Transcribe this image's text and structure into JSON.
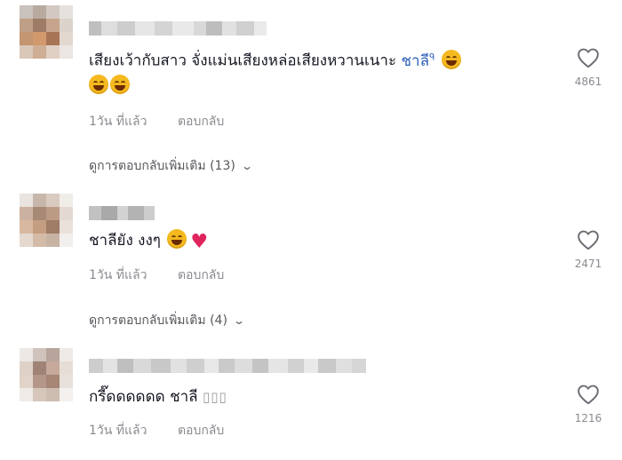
{
  "comments": [
    {
      "text": "เสียงเว้ากับสาว จั่งแม่นเสียงหล่อเสียงหวานเนาะ",
      "mention": "ชาลี",
      "mention_badge": "ᑫ",
      "time": "1วัน ที่แล้ว",
      "reply": "ตอบกลับ",
      "more_replies": "ดูการตอบกลับเพิ่มเติม (13)",
      "likes": "4861"
    },
    {
      "text": "ชาลียัง งงๆ",
      "time": "1วัน ที่แล้ว",
      "reply": "ตอบกลับ",
      "more_replies": "ดูการตอบกลับเพิ่มเติม (4)",
      "likes": "2471"
    },
    {
      "text": "กรี๊ดดดดดด ชาลี",
      "trailing": "▯▯▯",
      "time": "1วัน ที่แล้ว",
      "reply": "ตอบกลับ",
      "likes": "1216"
    }
  ],
  "icons": {
    "chevron": "chevron-down-icon",
    "like": "heart-outline-icon",
    "laugh": "rolling-laughing-emoji",
    "grin": "grinning-squint-emoji",
    "heart": "red-heart-emoji"
  },
  "colors": {
    "text": "#161823",
    "mention": "#2b5db9",
    "meta": "#8a8b91",
    "background": "#ffffff"
  }
}
